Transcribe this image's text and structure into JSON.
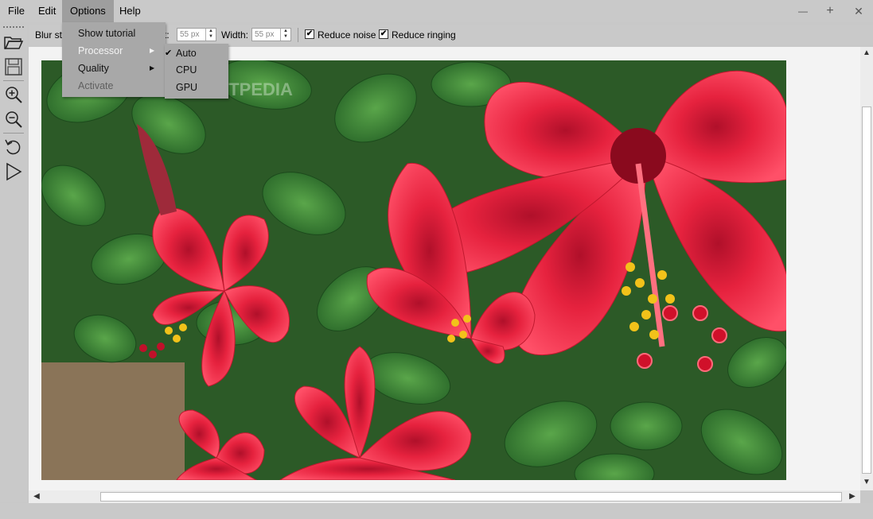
{
  "menubar": {
    "items": [
      {
        "label": "File"
      },
      {
        "label": "Edit"
      },
      {
        "label": "Options"
      },
      {
        "label": "Help"
      }
    ],
    "minimize": "—",
    "maximize": "+",
    "close": "✕"
  },
  "toolbar": {
    "blur_label": "Blur str",
    "size_label": "t:",
    "size_value": "55 px",
    "width_label": "Width:",
    "width_value": "55 px",
    "reduce_noise_label": "Reduce noise",
    "reduce_noise_checked": true,
    "reduce_ringing_label": "Reduce ringing",
    "reduce_ringing_checked": true,
    "check_glyph": "✔"
  },
  "options_menu": {
    "items": [
      {
        "label": "Show tutorial",
        "enabled": true,
        "submenu": false
      },
      {
        "label": "Processor",
        "enabled": true,
        "submenu": true
      },
      {
        "label": "Quality",
        "enabled": true,
        "submenu": true
      },
      {
        "label": "Activate",
        "enabled": false,
        "submenu": false
      }
    ],
    "submenu_arrow": "▶"
  },
  "processor_menu": {
    "items": [
      {
        "label": "Auto",
        "checked": true
      },
      {
        "label": "CPU",
        "checked": false
      },
      {
        "label": "GPU",
        "checked": false
      }
    ],
    "check_glyph": "✔"
  },
  "left_tools": [
    {
      "icon": "open-folder-icon"
    },
    {
      "icon": "save-icon"
    },
    {
      "icon": "zoom-in-icon"
    },
    {
      "icon": "zoom-out-icon"
    },
    {
      "icon": "rotate-icon"
    },
    {
      "icon": "play-icon"
    }
  ],
  "scrollbars": {
    "up": "▲",
    "down": "▼",
    "left": "◀",
    "right": "▶"
  },
  "colors": {
    "menu_bg": "#c9c9c9",
    "dropdown_bg": "#a8a8a8",
    "canvas_bg": "#f3f3f3",
    "flower_red": "#e8304a",
    "leaf_green": "#3f8a3a"
  }
}
